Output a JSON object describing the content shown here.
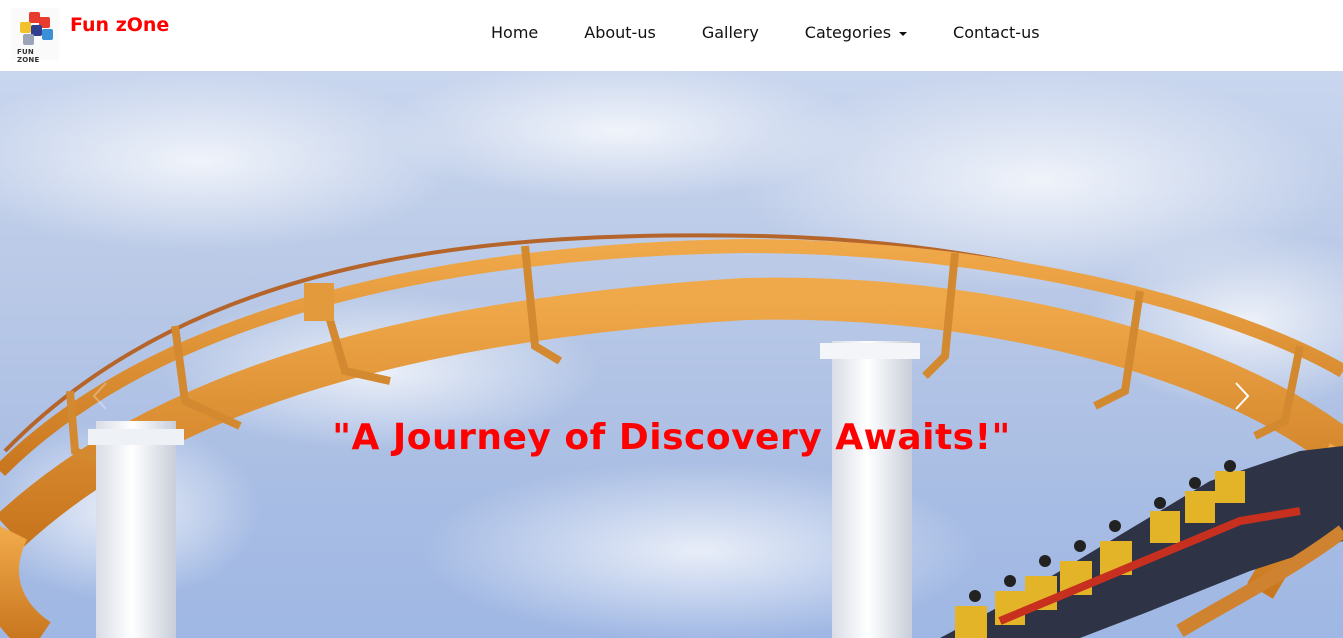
{
  "brand": {
    "logo_caption": "FUN ZONE",
    "name": "Fun zOne",
    "color": "#ff0000"
  },
  "nav": {
    "items": [
      {
        "label": "Home"
      },
      {
        "label": "About-us"
      },
      {
        "label": "Gallery"
      },
      {
        "label": "Categories",
        "dropdown": true
      },
      {
        "label": "Contact-us"
      }
    ]
  },
  "hero": {
    "caption": "\"A Journey of Discovery Awaits!\"",
    "caption_color": "#ff0000",
    "image": "roller-coaster-photo",
    "controls": {
      "prev_icon": "chevron-left-icon",
      "next_icon": "chevron-right-icon"
    }
  }
}
